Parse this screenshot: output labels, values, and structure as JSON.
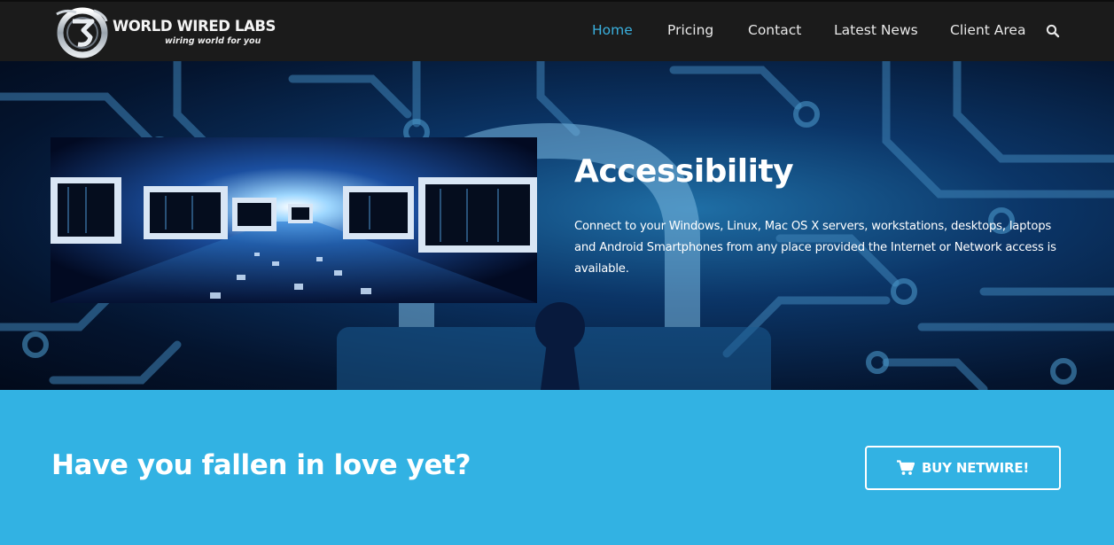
{
  "brand": {
    "name": "WORLD WIRED LABS",
    "tagline": "wiring world for you"
  },
  "nav": {
    "items": [
      {
        "label": "Home",
        "active": true
      },
      {
        "label": "Pricing",
        "active": false
      },
      {
        "label": "Contact",
        "active": false
      },
      {
        "label": "Latest News",
        "active": false
      },
      {
        "label": "Client Area",
        "active": false
      }
    ],
    "search_icon": "search-icon"
  },
  "hero": {
    "title": "Accessibility",
    "text": "Connect to your Windows, Linux, Mac OS X  servers, workstations, desktops, laptops and Android Smartphones from any place provided the Internet or Network access is available."
  },
  "cta": {
    "heading": "Have you fallen in love yet?",
    "button_label": "BUY NETWIRE!",
    "button_icon": "shopping-cart-icon"
  },
  "colors": {
    "header_bg": "#1b1b1b",
    "nav_active": "#3ab0de",
    "cta_bg": "#32b2e3"
  }
}
